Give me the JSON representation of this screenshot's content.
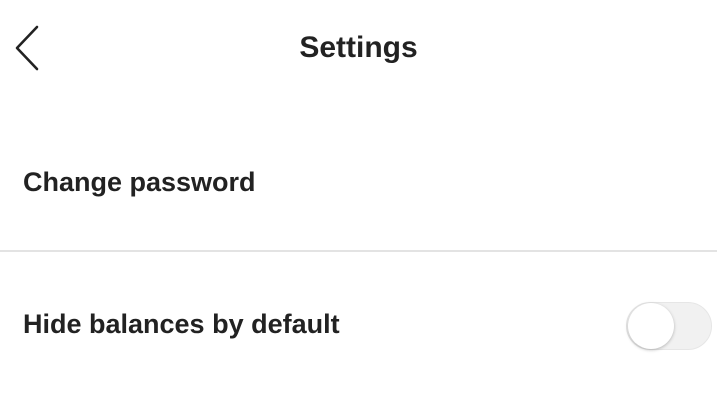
{
  "header": {
    "back_icon": "chevron-left-icon",
    "title": "Settings"
  },
  "settings": {
    "items": [
      {
        "label": "Change password"
      },
      {
        "label": "Hide balances by default",
        "toggle_on": false
      }
    ]
  },
  "colors": {
    "text": "#222222",
    "divider": "#e3e3e3",
    "toggle_off_track": "#f1f1f1",
    "toggle_knob": "#ffffff"
  }
}
